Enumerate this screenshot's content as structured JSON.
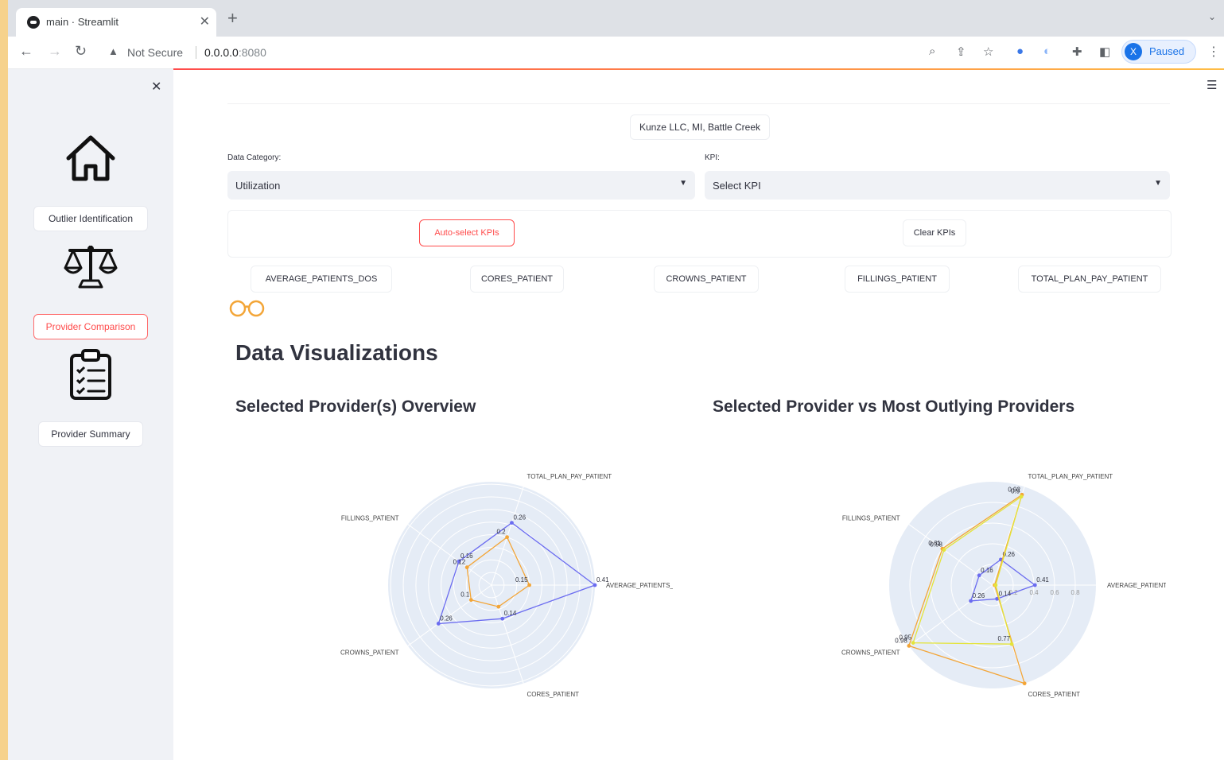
{
  "browser": {
    "tab_title": "main · Streamlit",
    "not_secure": "Not Secure",
    "url_host": "0.0.0.0",
    "url_port": ":8080",
    "profile_initial": "X",
    "profile_status": "Paused"
  },
  "sidebar": {
    "items": [
      {
        "label": "Outlier Identification",
        "icon": "home-icon",
        "active": false
      },
      {
        "label": "Provider Comparison",
        "icon": "scales-icon",
        "active": true
      },
      {
        "label": "Provider Summary",
        "icon": "clipboard-icon",
        "active": false
      }
    ]
  },
  "main": {
    "provider_label": "Kunze LLC, MI, Battle Creek",
    "data_category": {
      "label": "Data Category:",
      "value": "Utilization"
    },
    "kpis_select": {
      "label": "KPI:",
      "value": "Select KPI"
    },
    "auto_select_label": "Auto-select KPIs",
    "clear_label": "Clear KPIs",
    "kpi_tags": [
      "AVERAGE_PATIENTS_DOS",
      "CORES_PATIENT",
      "CROWNS_PATIENT",
      "FILLINGS_PATIENT",
      "TOTAL_PLAN_PAY_PATIENT"
    ],
    "section_title": "Data Visualizations",
    "chart1_title": "Selected Provider(s) Overview",
    "chart2_title": "Selected Provider vs Most Outlying Providers"
  },
  "colors": {
    "accent": "#ff4b4b",
    "blue": "#6b6cf0",
    "orange": "#f3a537",
    "yellow": "#e4e43a",
    "polar_bg": "#e5ecf6"
  },
  "chart_data": [
    {
      "type": "radar",
      "axes": [
        "AVERAGE_PATIENTS_DOS",
        "TOTAL_PLAN_PAY_PATIENT",
        "FILLINGS_PATIENT",
        "CROWNS_PATIENT",
        "CORES_PATIENT"
      ],
      "radial_range": [
        0,
        0.41
      ],
      "ticks": [
        0.05,
        0.1,
        0.15,
        0.2,
        0.25,
        0.3,
        0.35,
        0.4
      ],
      "series": [
        {
          "color": "#6b6cf0",
          "values": [
            0.41,
            0.26,
            0.16,
            0.26,
            0.14
          ],
          "labels": [
            "0.41",
            "0.26",
            "0.16",
            "0.26",
            "0.14"
          ]
        },
        {
          "color": "#f3a537",
          "values": [
            0.15,
            0.2,
            0.12,
            0.1,
            0.09
          ],
          "labels": [
            "0.15",
            "0.2",
            "0.12",
            "0.1",
            ""
          ]
        }
      ]
    },
    {
      "type": "radar",
      "axes": [
        "AVERAGE_PATIENTS_DOS",
        "TOTAL_PLAN_PAY_PATIENT",
        "FILLINGS_PATIENT",
        "CROWNS_PATIENT",
        "CORES_PATIENT"
      ],
      "radial_range": [
        0,
        1
      ],
      "ticks": [
        0.2,
        0.4,
        0.6,
        0.8
      ],
      "tick_labels": [
        "0.2",
        "0.4",
        "0.6",
        "0.8"
      ],
      "series": [
        {
          "color": "#6b6cf0",
          "values": [
            0.41,
            0.26,
            0.16,
            0.26,
            0.14
          ],
          "labels": [
            "0.41",
            "0.26",
            "0.16",
            "0.26",
            "0.14"
          ]
        },
        {
          "color": "#f3a537",
          "values": [
            0.02,
            0.92,
            0.6,
            1.0,
            1.0
          ],
          "labels": [
            "",
            "0.92",
            "0.61",
            "0.98",
            ""
          ]
        },
        {
          "color": "#e4e43a",
          "values": [
            0.03,
            0.9,
            0.58,
            0.95,
            0.6
          ],
          "labels": [
            "",
            "0.9",
            "0.58",
            "0.95",
            "0.77"
          ]
        }
      ]
    }
  ]
}
